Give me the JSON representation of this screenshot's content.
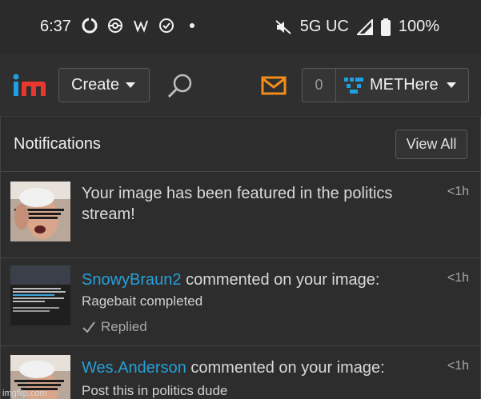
{
  "status_bar": {
    "time": "6:37",
    "icons_left": [
      "sync-icon",
      "pokeball-icon",
      "w-icon",
      "check-circle-icon",
      "dot-icon"
    ],
    "mute_icon": "mute-icon",
    "network": "5G UC",
    "battery": "100%"
  },
  "header": {
    "create_label": "Create",
    "notification_count": "0",
    "username": "METHere"
  },
  "notifications": {
    "title": "Notifications",
    "view_all_label": "View All",
    "items": [
      {
        "text": "Your image has been featured in the politics stream!",
        "time": "<1h"
      },
      {
        "user": "SnowyBraun2",
        "action": "commented on your image:",
        "comment": "Ragebait completed",
        "status": "Replied",
        "time": "<1h"
      },
      {
        "user": "Wes.Anderson",
        "action": "commented on your image:",
        "comment": "Post this in politics dude",
        "time": "<1h"
      }
    ]
  },
  "watermark": "imgflip.com",
  "colors": {
    "accent_link": "#26a0d8",
    "mail": "#f28c1a",
    "logo_i": "#1da1e2",
    "logo_m": "#e9372f",
    "avatar": "#1da1e2"
  }
}
